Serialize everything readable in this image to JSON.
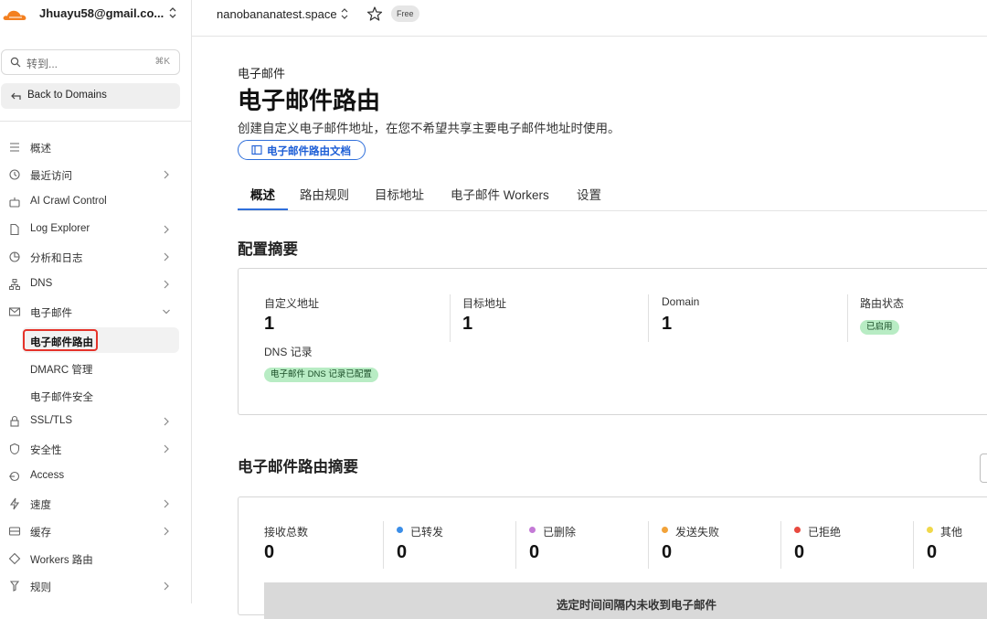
{
  "account": {
    "email": "Jhuayu58@gmail.co..."
  },
  "search": {
    "placeholder": "转到...",
    "shortcut": "⌘K"
  },
  "back_label": "Back to Domains",
  "sidebar": {
    "items": [
      {
        "label": "概述",
        "icon": "list-icon"
      },
      {
        "label": "最近访问",
        "icon": "clock-icon"
      },
      {
        "label": "AI Crawl Control",
        "icon": "robot-icon"
      },
      {
        "label": "Log Explorer",
        "icon": "file-icon"
      },
      {
        "label": "分析和日志",
        "icon": "chart-icon"
      },
      {
        "label": "DNS",
        "icon": "network-icon"
      },
      {
        "label": "电子邮件",
        "icon": "mail-icon"
      },
      {
        "label": "SSL/TLS",
        "icon": "lock-icon"
      },
      {
        "label": "安全性",
        "icon": "shield-icon"
      },
      {
        "label": "Access",
        "icon": "access-icon"
      },
      {
        "label": "速度",
        "icon": "bolt-icon"
      },
      {
        "label": "缓存",
        "icon": "cache-icon"
      },
      {
        "label": "Workers 路由",
        "icon": "workers-icon"
      },
      {
        "label": "规则",
        "icon": "rules-icon"
      }
    ],
    "email_sub": [
      "电子邮件路由",
      "DMARC 管理",
      "电子邮件安全"
    ]
  },
  "topbar": {
    "site": "nanobananatest.space",
    "plan": "Free"
  },
  "page": {
    "eyebrow": "电子邮件",
    "title": "电子邮件路由",
    "description": "创建自定义电子邮件地址，在您不希望共享主要电子邮件地址时使用。",
    "doc_button": "电子邮件路由文档"
  },
  "tabs": [
    "概述",
    "路由规则",
    "目标地址",
    "电子邮件 Workers",
    "设置"
  ],
  "config": {
    "title": "配置摘要",
    "stats": [
      {
        "label": "自定义地址",
        "value": "1"
      },
      {
        "label": "目标地址",
        "value": "1"
      },
      {
        "label": "Domain",
        "value": "1"
      },
      {
        "label": "路由状态",
        "badge": "已启用"
      }
    ],
    "dns_label": "DNS 记录",
    "dns_badge": "电子邮件 DNS 记录已配置"
  },
  "summary": {
    "title": "电子邮件路由摘要",
    "stats": [
      {
        "label": "接收总数",
        "value": "0",
        "color": ""
      },
      {
        "label": "已转发",
        "value": "0",
        "color": "#3b8ee8"
      },
      {
        "label": "已删除",
        "value": "0",
        "color": "#c47ad6"
      },
      {
        "label": "发送失败",
        "value": "0",
        "color": "#f2a33a"
      },
      {
        "label": "已拒绝",
        "value": "0",
        "color": "#e8493f"
      },
      {
        "label": "其他",
        "value": "0",
        "color": "#f0d84a"
      }
    ],
    "empty_text": "选定时间间隔内未收到电子邮件"
  }
}
